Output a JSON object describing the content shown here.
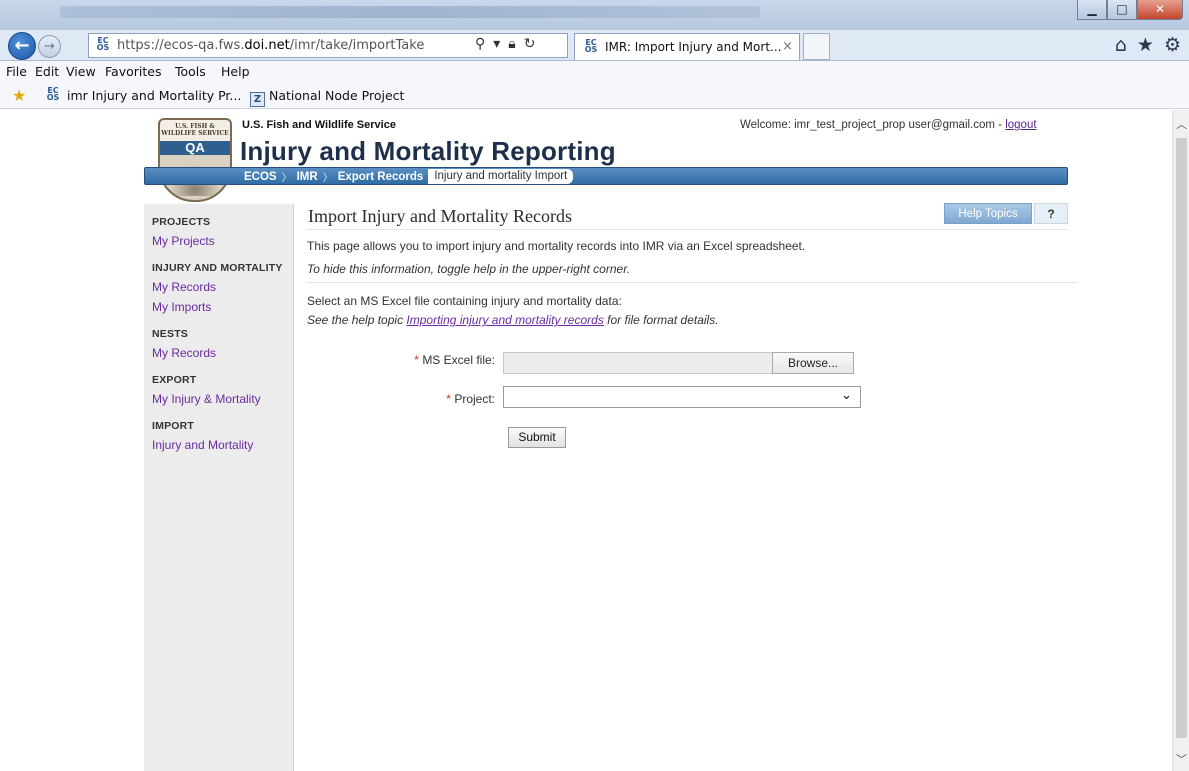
{
  "browser": {
    "url_prefix": "https://ecos-qa.fws.",
    "url_domain": "doi.net",
    "url_path": "/imr/take/importTake",
    "tab_title": "IMR: Import Injury and Mort...",
    "tab_close": "×",
    "ecos_icon": "ECOS",
    "menu": [
      "File",
      "Edit",
      "View",
      "Favorites",
      "Tools",
      "Help"
    ],
    "favorites": [
      {
        "label": "imr Injury and Mortality Pr...",
        "icon": "ecos-icon"
      },
      {
        "label": "National Node Project",
        "icon": "z-icon"
      }
    ]
  },
  "header": {
    "seal_text": "U.S. FISH & WILDLIFE SERVICE",
    "seal_badge": "QA",
    "agency": "U.S. Fish and Wildlife Service",
    "title": "Injury and Mortality Reporting",
    "welcome_text": "Welcome: imr_test_project_prop user@gmail.com -",
    "logout": "logout",
    "breadcrumb": [
      "ECOS",
      "IMR",
      "Export Records",
      "Injury and mortality Import"
    ]
  },
  "sidebar": {
    "sections": [
      {
        "heading": "PROJECTS",
        "links": [
          "My Projects"
        ]
      },
      {
        "heading": "INJURY AND MORTALITY",
        "links": [
          "My Records",
          "My Imports"
        ]
      },
      {
        "heading": "NESTS",
        "links": [
          "My Records"
        ]
      },
      {
        "heading": "EXPORT",
        "links": [
          "My Injury & Mortality"
        ]
      },
      {
        "heading": "IMPORT",
        "links": [
          "Injury and Mortality"
        ]
      }
    ]
  },
  "main": {
    "title": "Import Injury and Mortality Records",
    "help_topics": "Help Topics",
    "help_q": "?",
    "intro": "This page allows you to import injury and mortality records into IMR via an Excel spreadsheet.",
    "toggle_hint": "To hide this information, toggle help in the upper-right corner.",
    "select_text": "Select an MS Excel file containing injury and mortality data:",
    "help_prefix": "See the help topic ",
    "help_link": "Importing injury and mortality records",
    "help_suffix": " for file format details.",
    "required_mark": "*",
    "excel_label": "MS Excel file:",
    "browse_label": "Browse...",
    "project_label": "Project:",
    "project_value": "",
    "submit_label": "Submit"
  }
}
